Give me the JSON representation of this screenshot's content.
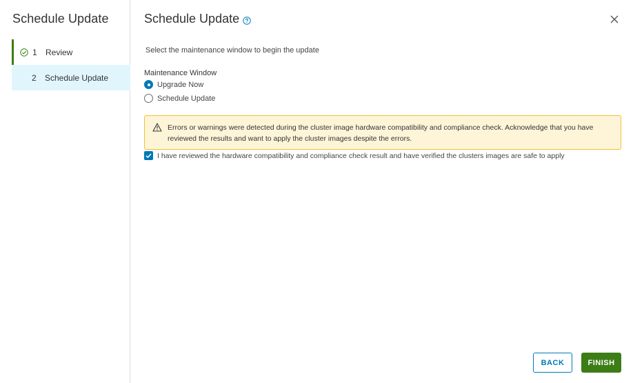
{
  "sidebar": {
    "title": "Schedule Update",
    "steps": [
      {
        "number": "1",
        "label": "Review",
        "state": "completed",
        "icon": "check-circle-icon"
      },
      {
        "number": "2",
        "label": "Schedule Update",
        "state": "active"
      }
    ]
  },
  "main": {
    "title": "Schedule Update",
    "help_icon": "help-circle-icon",
    "close_icon": "close-icon",
    "instruction": "Select the maintenance window to begin the update",
    "maintenance_window": {
      "label": "Maintenance Window",
      "options": [
        {
          "label": "Upgrade Now",
          "selected": true
        },
        {
          "label": "Schedule Update",
          "selected": false
        }
      ]
    },
    "alert": {
      "icon": "warning-triangle-icon",
      "text": "Errors or warnings were detected during the cluster image hardware compatibility and compliance check. Acknowledge that you have reviewed the results and want to apply the cluster images despite the errors."
    },
    "acknowledge": {
      "checked": true,
      "label": "I have reviewed the hardware compatibility and compliance check result and have verified the clusters images are safe to apply"
    }
  },
  "footer": {
    "back_label": "BACK",
    "finish_label": "FINISH"
  },
  "colors": {
    "primary": "#0079b8",
    "success": "#3c7d16",
    "active_step_bg": "#e1f5fd",
    "warning_bg": "#fef5d9",
    "warning_border": "#f2c12e"
  }
}
